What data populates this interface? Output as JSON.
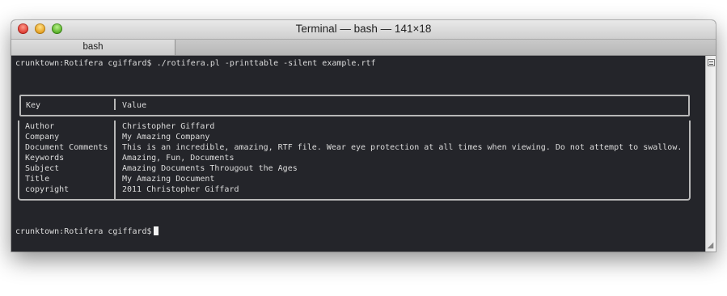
{
  "window": {
    "title": "Terminal — bash — 141×18",
    "tab_label": "bash"
  },
  "terminal": {
    "command_line": "crunktown:Rotifera cgiffard$ ./rotifera.pl -printtable -silent example.rtf",
    "prompt": "crunktown:Rotifera cgiffard$",
    "table": {
      "headers": [
        "Key",
        "Value"
      ],
      "rows": [
        {
          "key": "Author",
          "value": "Christopher Giffard"
        },
        {
          "key": "Company",
          "value": "My Amazing Company"
        },
        {
          "key": "Document Comments",
          "value": "This is an incredible, amazing, RTF file. Wear eye protection at all times when viewing. Do not attempt to swallow."
        },
        {
          "key": "Keywords",
          "value": "Amazing, Fun, Documents"
        },
        {
          "key": "Subject",
          "value": "Amazing Documents Througout the Ages"
        },
        {
          "key": "Title",
          "value": "My Amazing Document"
        },
        {
          "key": "copyright",
          "value": "2011 Christopher Giffard"
        }
      ]
    }
  },
  "icons": {
    "scrollbar_button": "scroll-lines-icon",
    "resize": "resize-grip-icon"
  }
}
